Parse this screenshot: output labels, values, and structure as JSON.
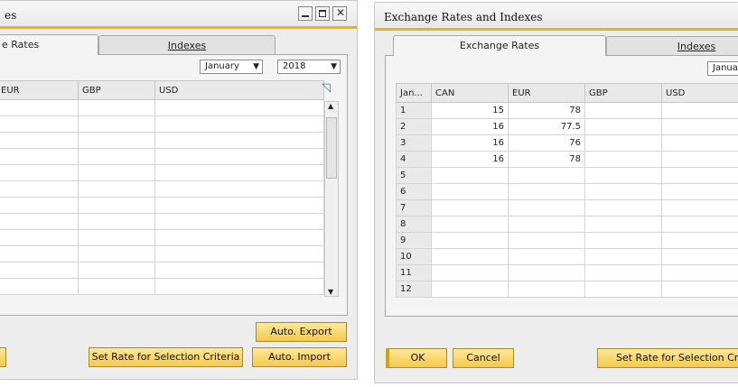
{
  "left_window": {
    "title_fragment": "es",
    "tabs": [
      {
        "label": "e Rates",
        "active": true
      },
      {
        "label": "Indexes",
        "active": false
      }
    ],
    "month": "January",
    "year": "2018",
    "columns": [
      "EUR",
      "GBP",
      "USD"
    ],
    "buttons": {
      "auto_export": "Auto. Export",
      "set_rate": "Set Rate for Selection Criteria",
      "auto_import": "Auto. Import"
    }
  },
  "right_window": {
    "title": "Exchange Rates and Indexes",
    "tabs": [
      {
        "label": "Exchange Rates",
        "active": true
      },
      {
        "label": "Indexes",
        "active": false
      }
    ],
    "month_fragment": "Januar",
    "columns": [
      "Jan...",
      "CAN",
      "EUR",
      "GBP",
      "USD"
    ],
    "rows": [
      {
        "day": "1",
        "CAN": "15",
        "EUR": "78"
      },
      {
        "day": "2",
        "CAN": "16",
        "EUR": "77.5"
      },
      {
        "day": "3",
        "CAN": "16",
        "EUR": "76"
      },
      {
        "day": "4",
        "CAN": "16",
        "EUR": "78"
      },
      {
        "day": "5",
        "CAN": "",
        "EUR": ""
      },
      {
        "day": "6",
        "CAN": "",
        "EUR": ""
      },
      {
        "day": "7",
        "CAN": "",
        "EUR": ""
      },
      {
        "day": "8",
        "CAN": "",
        "EUR": ""
      },
      {
        "day": "9",
        "CAN": "",
        "EUR": ""
      },
      {
        "day": "10",
        "CAN": "",
        "EUR": ""
      },
      {
        "day": "11",
        "CAN": "",
        "EUR": ""
      },
      {
        "day": "12",
        "CAN": "",
        "EUR": ""
      }
    ],
    "buttons": {
      "ok": "OK",
      "cancel": "Cancel",
      "set_rate": "Set Rate for Selection Criteri"
    }
  },
  "colors": {
    "accent": "#f0b400",
    "button": "#f6c94a"
  }
}
